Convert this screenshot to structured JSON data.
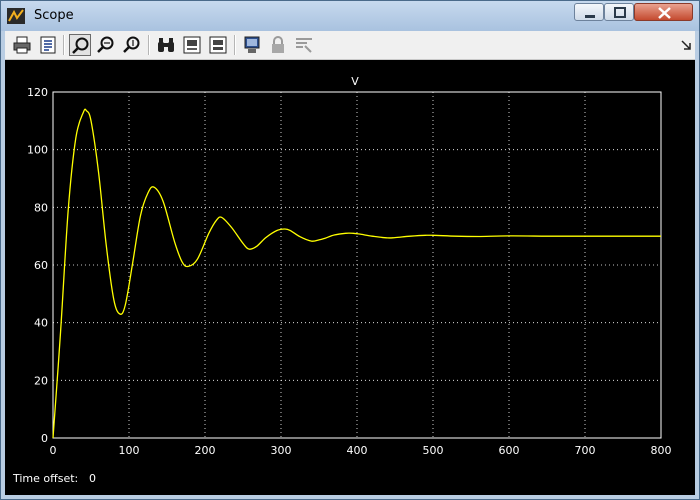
{
  "window": {
    "title": "Scope",
    "icon": "simulink-scope-icon",
    "buttons": [
      "minimize",
      "maximize",
      "close"
    ]
  },
  "toolbar": {
    "tools": [
      {
        "name": "print",
        "icon": "printer-icon"
      },
      {
        "name": "parameters",
        "icon": "parameters-icon"
      },
      {
        "name": "zoom",
        "icon": "zoom-icon",
        "active": true
      },
      {
        "name": "zoom-x",
        "icon": "zoom-x-icon"
      },
      {
        "name": "zoom-y",
        "icon": "zoom-y-icon"
      },
      {
        "name": "autoscale",
        "icon": "binoculars-icon"
      },
      {
        "name": "save-axes",
        "icon": "save-axes-icon"
      },
      {
        "name": "restore-axes",
        "icon": "restore-axes-icon"
      },
      {
        "name": "floating-scope",
        "icon": "floating-scope-icon"
      },
      {
        "name": "lock-axes",
        "icon": "lock-icon",
        "disabled": true
      },
      {
        "name": "signal-selection",
        "icon": "signal-selection-icon",
        "disabled": true
      }
    ]
  },
  "status": {
    "time_offset_label": "Time offset:",
    "time_offset_value": "0"
  },
  "colors": {
    "plot_background": "#000000",
    "axes_color": "#ffffff",
    "signal_color": "#ffff00",
    "window_frame": "#b9cde3",
    "close_button": "#c44a2f"
  },
  "chart_data": {
    "type": "line",
    "title": "V",
    "xlabel": "",
    "ylabel": "",
    "xlim": [
      0,
      800
    ],
    "ylim": [
      0,
      120
    ],
    "xticks": [
      0,
      100,
      200,
      300,
      400,
      500,
      600,
      700,
      800
    ],
    "yticks": [
      0,
      20,
      40,
      60,
      80,
      100,
      120
    ],
    "grid": true,
    "series": [
      {
        "x": [
          0,
          10,
          20,
          30,
          40,
          44,
          50,
          60,
          70,
          80,
          88,
          95,
          105,
          115,
          125,
          133,
          145,
          160,
          170,
          178,
          190,
          205,
          215,
          222,
          235,
          250,
          258,
          268,
          280,
          295,
          305,
          312,
          325,
          340,
          350,
          358,
          370,
          385,
          395,
          402,
          420,
          440,
          450,
          470,
          490,
          500,
          530,
          560,
          600,
          650,
          700,
          750,
          800
        ],
        "y": [
          0,
          37,
          79,
          104,
          113,
          113.5,
          110,
          92,
          67,
          48,
          43,
          46,
          61,
          77,
          85,
          87,
          82,
          68,
          61,
          59.5,
          62,
          71,
          75.5,
          76.5,
          73,
          67.5,
          65.5,
          66.5,
          69.5,
          72,
          72.5,
          72,
          69.8,
          68.3,
          68.7,
          69.3,
          70.4,
          71,
          71,
          70.8,
          70,
          69.4,
          69.5,
          70,
          70.3,
          70.3,
          70,
          69.9,
          70.1,
          70,
          70,
          70,
          70
        ]
      }
    ]
  }
}
